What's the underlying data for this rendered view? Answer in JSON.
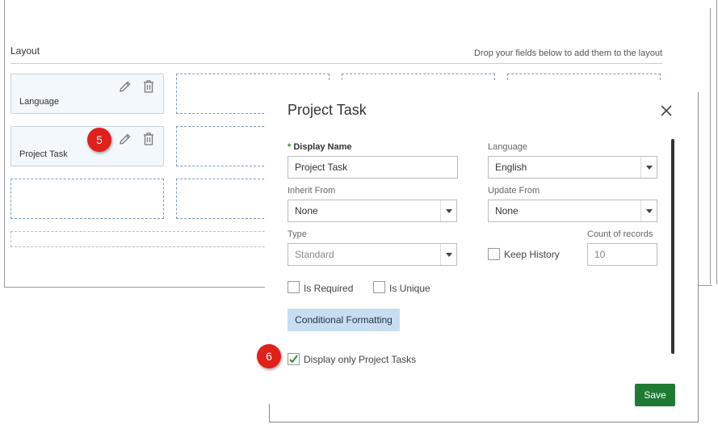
{
  "layout": {
    "title": "Layout",
    "hint": "Drop your fields below to add them to the layout",
    "fields": [
      {
        "label": "Language"
      },
      {
        "label": "Project Task"
      }
    ]
  },
  "annotations": {
    "step5": "5",
    "step6": "6"
  },
  "modal": {
    "title": "Project Task",
    "display_name": {
      "label": "Display Name",
      "required_mark": "*",
      "value": "Project Task"
    },
    "language": {
      "label": "Language",
      "value": "English"
    },
    "inherit_from": {
      "label": "Inherit From",
      "value": "None"
    },
    "update_from": {
      "label": "Update From",
      "value": "None"
    },
    "type": {
      "label": "Type",
      "value": "Standard"
    },
    "keep_history": {
      "label": "Keep History",
      "checked": false
    },
    "count_of_records": {
      "label": "Count of records",
      "value": "10"
    },
    "is_required": {
      "label": "Is Required",
      "checked": false
    },
    "is_unique": {
      "label": "Is Unique",
      "checked": false
    },
    "conditional_formatting_label": "Conditional Formatting",
    "display_only": {
      "label": "Display only Project Tasks",
      "checked": true
    },
    "save_label": "Save"
  },
  "colors": {
    "save_button": "#1f7a34",
    "badge": "#e0201a",
    "conditional_button": "#c7def2",
    "required_star": "#2e8b3a"
  }
}
